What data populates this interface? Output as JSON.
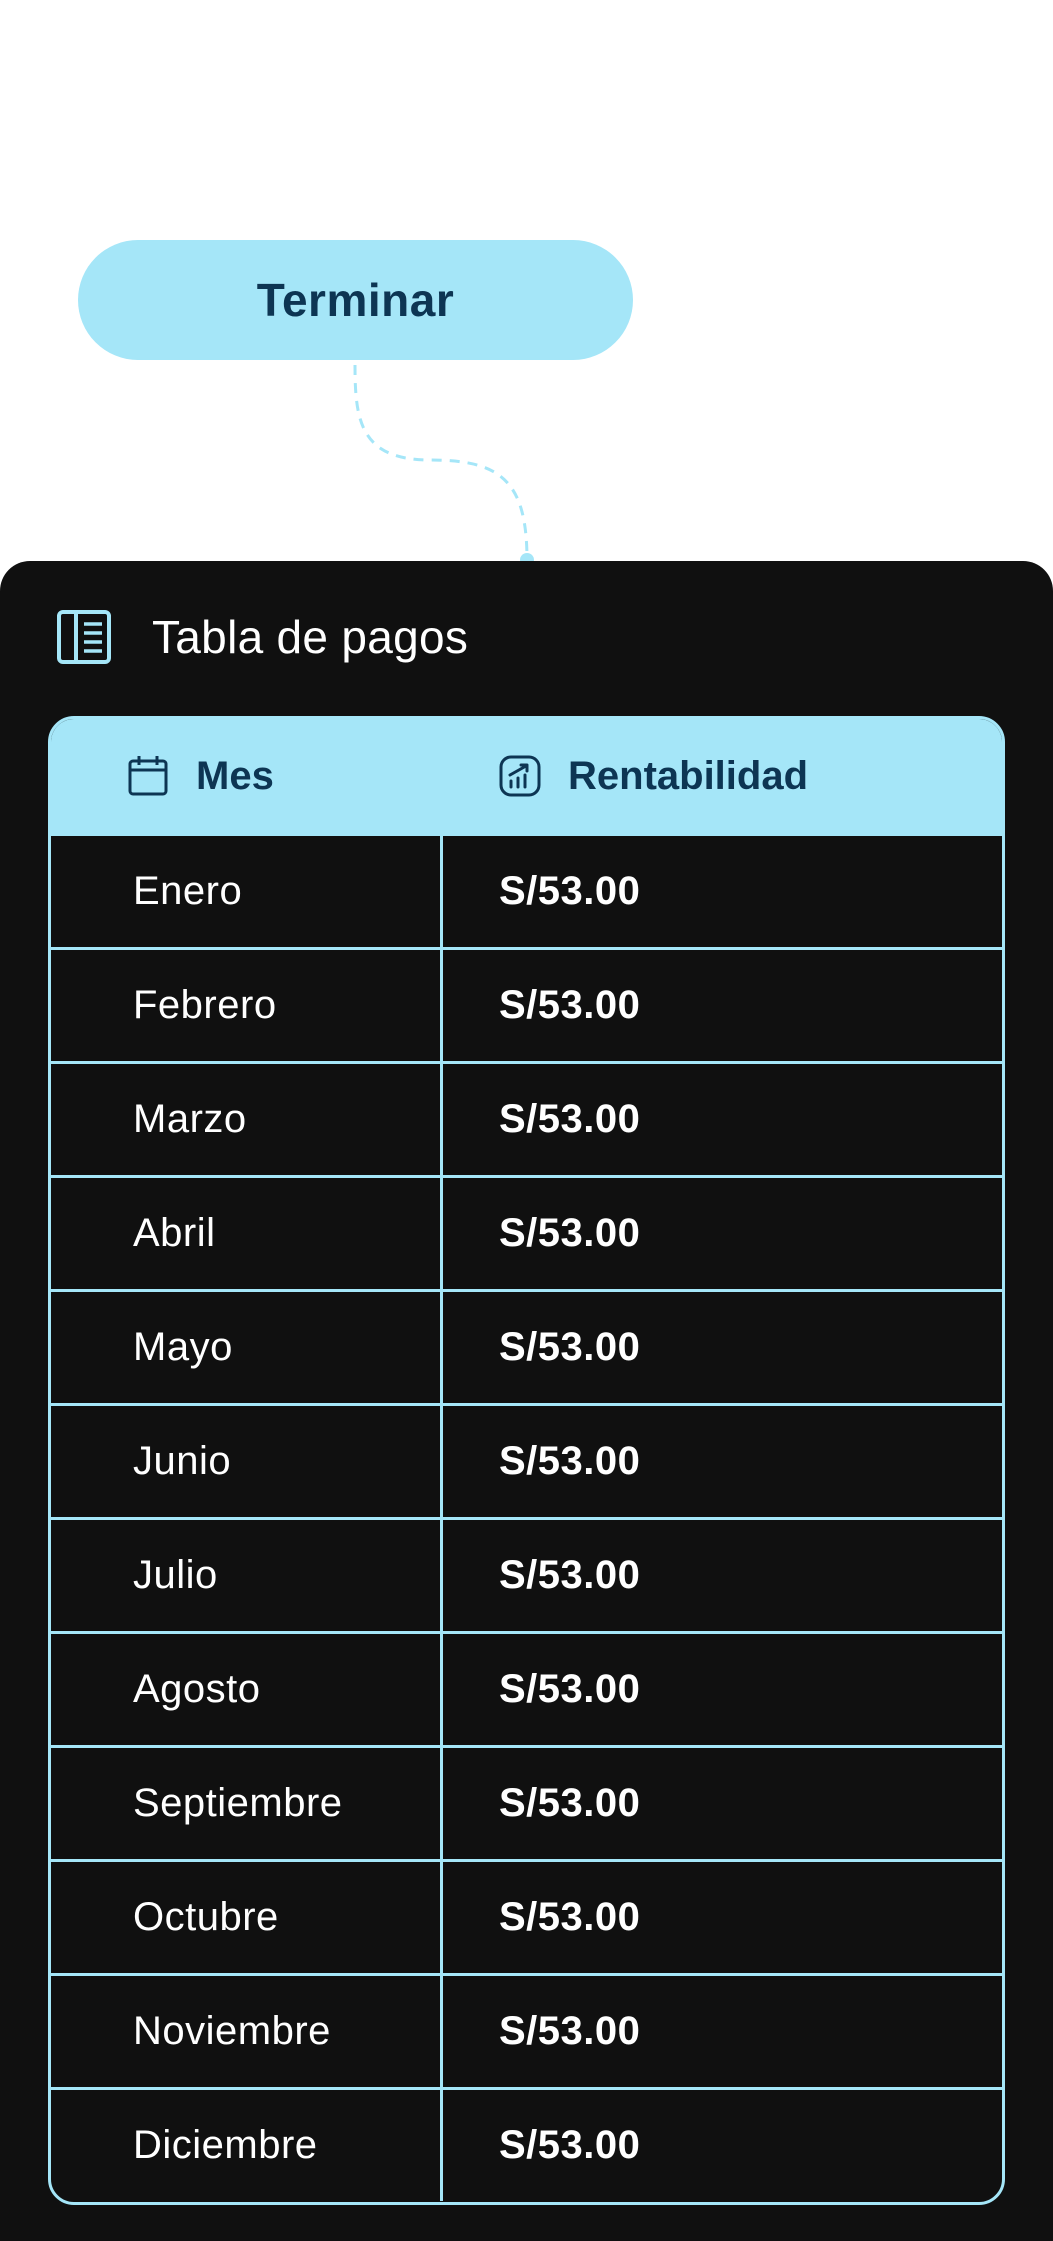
{
  "action": {
    "terminar_label": "Terminar"
  },
  "panel": {
    "title": "Tabla de pagos",
    "icon": "table-icon",
    "columns": [
      {
        "label": "Mes",
        "icon": "calendar-icon"
      },
      {
        "label": "Rentabilidad",
        "icon": "chart-growth-icon"
      }
    ],
    "rows": [
      {
        "mes": "Enero",
        "valor": "S/53.00"
      },
      {
        "mes": "Febrero",
        "valor": "S/53.00"
      },
      {
        "mes": "Marzo",
        "valor": "S/53.00"
      },
      {
        "mes": "Abril",
        "valor": "S/53.00"
      },
      {
        "mes": "Mayo",
        "valor": "S/53.00"
      },
      {
        "mes": "Junio",
        "valor": "S/53.00"
      },
      {
        "mes": "Julio",
        "valor": "S/53.00"
      },
      {
        "mes": "Agosto",
        "valor": "S/53.00"
      },
      {
        "mes": "Septiembre",
        "valor": "S/53.00"
      },
      {
        "mes": "Octubre",
        "valor": "S/53.00"
      },
      {
        "mes": "Noviembre",
        "valor": "S/53.00"
      },
      {
        "mes": "Diciembre",
        "valor": "S/53.00"
      }
    ]
  },
  "colors": {
    "accent": "#a5e6f8",
    "accent_text": "#0d3553",
    "panel_bg": "#101010",
    "text": "#ffffff"
  }
}
